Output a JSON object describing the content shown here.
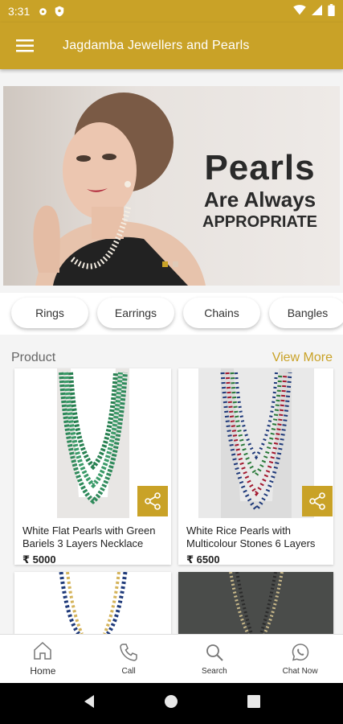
{
  "status_bar": {
    "time": "3:31"
  },
  "app_bar": {
    "title": "Jagdamba Jewellers and Pearls"
  },
  "banner": {
    "line1": "Pearls",
    "line2": "Are Always",
    "line3": "APPROPRIATE"
  },
  "categories": [
    "Rings",
    "Earrings",
    "Chains",
    "Bangles"
  ],
  "product_section": {
    "title": "Product",
    "view_more": "View More"
  },
  "products": [
    {
      "name": "White Flat Pearls with Green Bariels 3 Layers Necklace",
      "price": "₹ 5000"
    },
    {
      "name": "White Rice Pearls with Multicolour Stones 6 Layers",
      "price": "₹ 6500"
    }
  ],
  "bottom_nav": [
    {
      "label": "Home",
      "icon": "home-icon"
    },
    {
      "label": "Call",
      "icon": "phone-icon"
    },
    {
      "label": "Search",
      "icon": "search-icon"
    },
    {
      "label": "Chat Now",
      "icon": "whatsapp-icon"
    }
  ],
  "colors": {
    "primary": "#c9a227",
    "accent": "#c9a227"
  }
}
